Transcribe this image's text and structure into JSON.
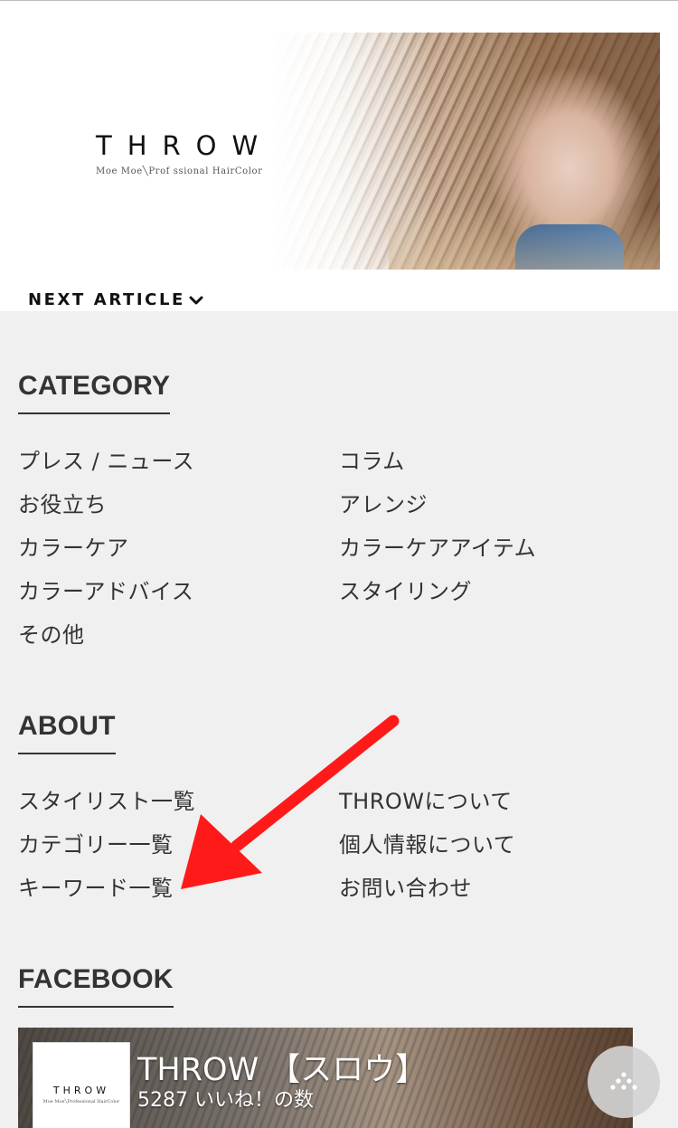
{
  "banner": {
    "brand_name": "THROW",
    "brand_tagline": "Moe Moe╲Prof ssional HairColor"
  },
  "next_article": {
    "label": "NEXT ARTICLE"
  },
  "category": {
    "title": "CATEGORY",
    "items": [
      {
        "label": "プレス / ニュース"
      },
      {
        "label": "コラム"
      },
      {
        "label": "お役立ち"
      },
      {
        "label": "アレンジ"
      },
      {
        "label": "カラーケア"
      },
      {
        "label": "カラーケアアイテム"
      },
      {
        "label": "カラーアドバイス"
      },
      {
        "label": "スタイリング"
      },
      {
        "label": "その他"
      }
    ]
  },
  "about": {
    "title": "ABOUT",
    "items": [
      {
        "label": "スタイリスト一覧"
      },
      {
        "label": "THROWについて"
      },
      {
        "label": "カテゴリー一覧"
      },
      {
        "label": "個人情報について"
      },
      {
        "label": "キーワード一覧"
      },
      {
        "label": "お問い合わせ"
      }
    ]
  },
  "facebook": {
    "title": "FACEBOOK",
    "page_name": "THROW 【スロウ】",
    "likes": "5287 いいね！の数",
    "thumb_name": "THROW",
    "thumb_tagline": "Moe Moe╲Professional HairColor"
  },
  "annotation": {
    "arrow_color": "#ff1a1a"
  },
  "floating_button": {
    "icon": "dots-triangle-icon"
  }
}
